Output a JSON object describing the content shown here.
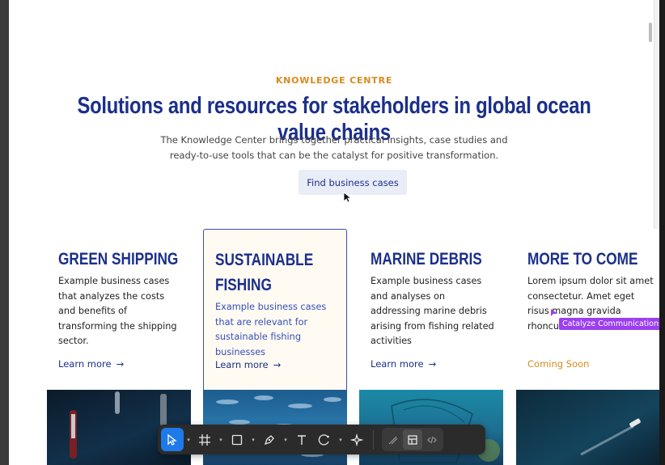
{
  "hero": {
    "eyebrow": "KNOWLEDGE CENTRE",
    "title": "Solutions and resources for stakeholders in global ocean value chains",
    "subtitle": "The Knowledge Center brings together practical insights, case studies and ready-to-use tools that can be the catalyst for positive transformation.",
    "cta_label": "Find business cases"
  },
  "cards": [
    {
      "title": "GREEN SHIPPING",
      "description": "Example business cases that analyzes the costs and benefits of transforming the shipping sector.",
      "link": "Learn more",
      "arrow": "→"
    },
    {
      "title": "SUSTAINABLE FISHING",
      "description": "Example business cases that are relevant for sustainable fishing businesses",
      "link": "Learn more",
      "arrow": "→"
    },
    {
      "title": "MARINE DEBRIS",
      "description": "Example business cases and analyses on addressing marine debris arising from fishing related activities",
      "link": "Learn more",
      "arrow": "→"
    },
    {
      "title": "MORE TO COME",
      "description": "Lorem ipsum dolor sit amet consectetur. Amet eget risus magna gravida rhoncus tortor n",
      "link": "Coming Soon"
    }
  ],
  "tooltip": "Catalyze Communications",
  "toolbar": {
    "tools": [
      "move-icon",
      "frame-icon",
      "rectangle-icon",
      "pen-icon",
      "text-icon",
      "shape-icon",
      "ai-icon"
    ],
    "modes": [
      "draw-mode-icon",
      "design-mode-icon",
      "dev-mode-icon"
    ]
  },
  "colors": {
    "accent": "#1b2f8a",
    "orange": "#d98a1e",
    "highlight": "#3450b8",
    "tooltip": "#9b3ff0",
    "active_tool": "#1e7ae8"
  }
}
